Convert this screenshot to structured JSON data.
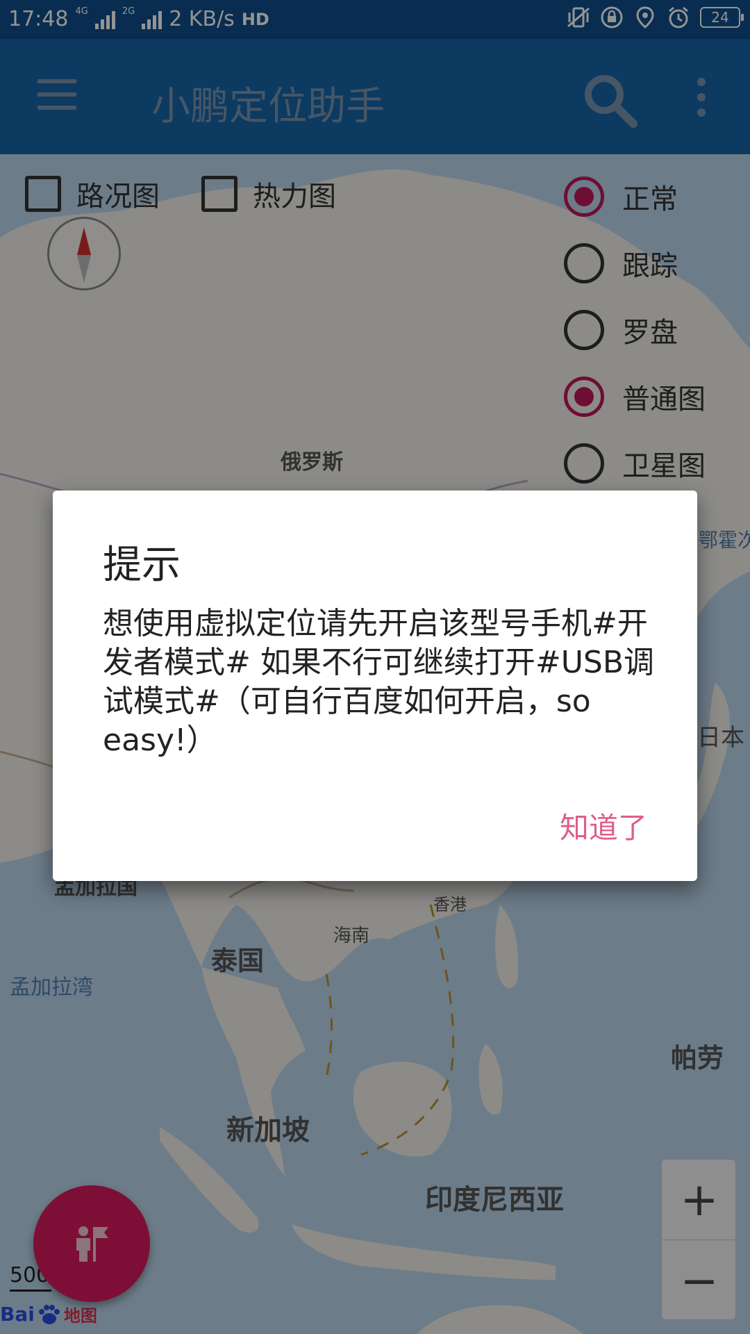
{
  "status_bar": {
    "time": "17:48",
    "net1": "4G",
    "net2": "2G",
    "speed": "2 KB/s",
    "hd": "HD",
    "battery": "24"
  },
  "app_bar": {
    "title": "小鹏定位助手"
  },
  "map_controls": {
    "traffic_label": "路况图",
    "heat_label": "热力图",
    "radios": [
      {
        "label": "正常",
        "selected": true
      },
      {
        "label": "跟踪",
        "selected": false
      },
      {
        "label": "罗盘",
        "selected": false
      },
      {
        "label": "普通图",
        "selected": true
      },
      {
        "label": "卫星图",
        "selected": false
      }
    ]
  },
  "map_labels": {
    "russia": "俄罗斯",
    "okhotsk": "鄂霍次",
    "japan": "日本",
    "bangladesh": "孟加拉国",
    "hongkong": "香港",
    "hainan": "海南",
    "thailand": "泰国",
    "bay_of_bengal": "孟加拉湾",
    "palau": "帕劳",
    "singapore": "新加坡",
    "indonesia": "印度尼西亚"
  },
  "map_footer": {
    "scale": "500",
    "logo_text": "Bai",
    "logo_map": "地图"
  },
  "zoom": {
    "in": "+",
    "out": "−"
  },
  "dialog": {
    "title": "提示",
    "message": "想使用虚拟定位请先开启该型号手机#开发者模式# 如果不行可继续打开#USB调试模式#（可自行百度如何开启，so easy!）",
    "button": "知道了"
  },
  "colors": {
    "status_bar": "#0f4e8b",
    "app_bar": "#1565a8",
    "accent": "#c2185b",
    "fab": "#d81b60",
    "dialog_button": "#e05d8c"
  }
}
